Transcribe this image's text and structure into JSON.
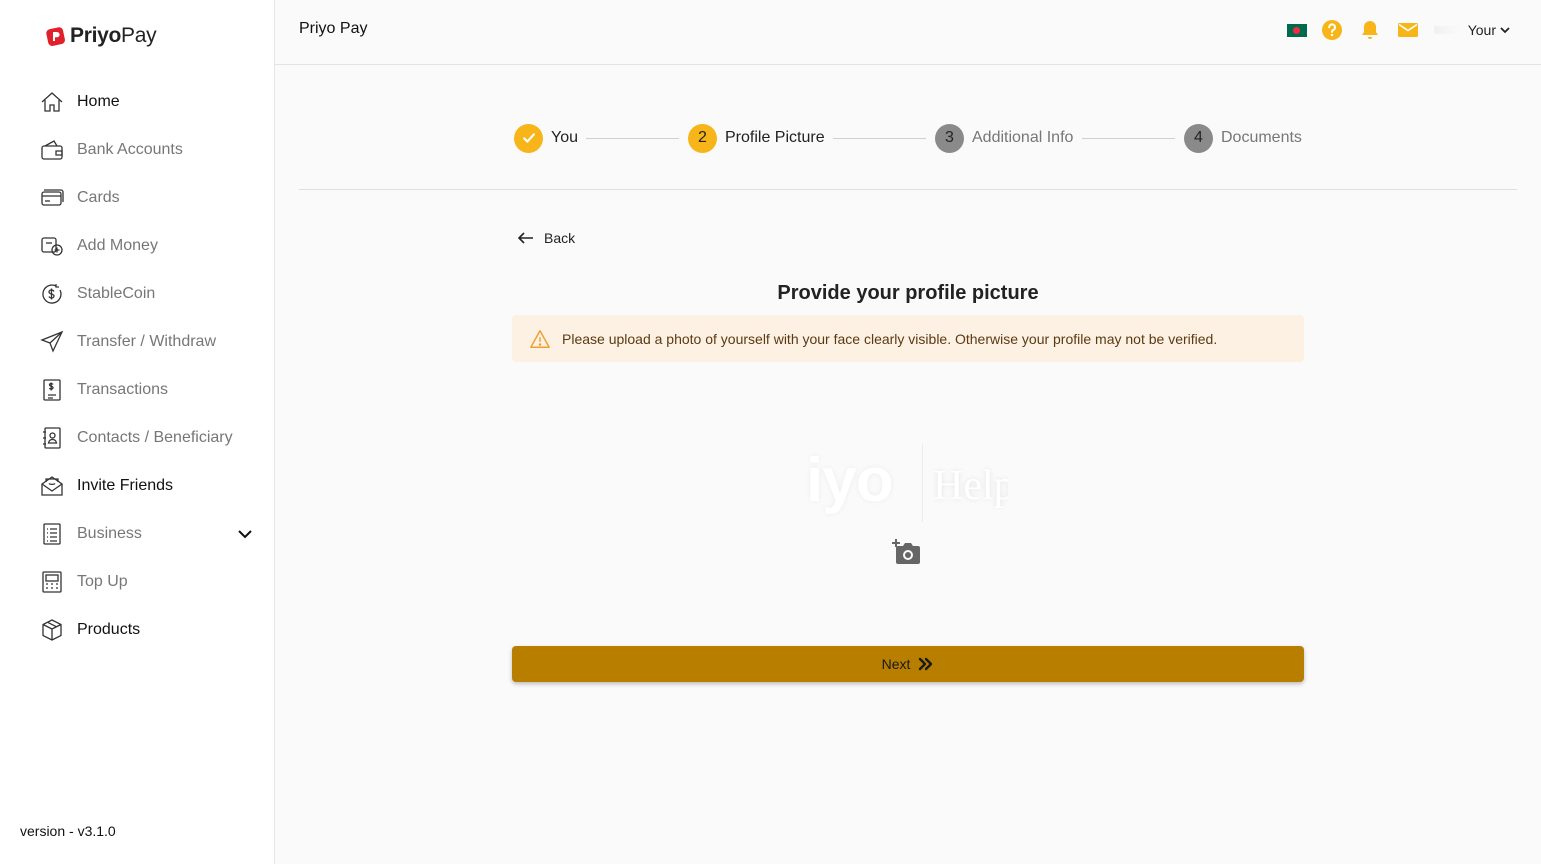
{
  "brand": {
    "bold": "Priyo",
    "light": "Pay",
    "color": "#e0202a"
  },
  "sidebar": {
    "items": [
      {
        "label": "Home",
        "icon": "home-icon",
        "strong": true
      },
      {
        "label": "Bank Accounts",
        "icon": "bank-wallet-icon",
        "strong": false
      },
      {
        "label": "Cards",
        "icon": "card-icon",
        "strong": false
      },
      {
        "label": "Add Money",
        "icon": "add-money-icon",
        "strong": false
      },
      {
        "label": "StableCoin",
        "icon": "stablecoin-icon",
        "strong": false
      },
      {
        "label": "Transfer / Withdraw",
        "icon": "paper-plane-icon",
        "strong": false
      },
      {
        "label": "Transactions",
        "icon": "receipt-icon",
        "strong": false
      },
      {
        "label": "Contacts / Beneficiary",
        "icon": "contacts-book-icon",
        "strong": false
      },
      {
        "label": "Invite Friends",
        "icon": "envelope-invite-icon",
        "strong": true
      },
      {
        "label": "Business",
        "icon": "document-list-icon",
        "strong": false
      },
      {
        "label": "Top Up",
        "icon": "top-up-icon",
        "strong": false
      },
      {
        "label": "Products",
        "icon": "box-icon",
        "strong": true
      }
    ],
    "version": "version - v3.1.0"
  },
  "header": {
    "title": "Priyo Pay",
    "user_label": "Your",
    "icons": [
      "bangladesh-flag-icon",
      "help-icon",
      "bell-icon",
      "mail-icon"
    ],
    "accent": "#f7b51a"
  },
  "stepper": {
    "steps": [
      {
        "number": "✓",
        "label": "You",
        "state": "done"
      },
      {
        "number": "2",
        "label": "Profile Picture",
        "state": "active"
      },
      {
        "number": "3",
        "label": "Additional Info",
        "state": "pending"
      },
      {
        "number": "4",
        "label": "Documents",
        "state": "pending"
      }
    ]
  },
  "content": {
    "back_label": "Back",
    "title": "Provide your profile picture",
    "warning": "Please upload a photo of yourself with your face clearly visible. Otherwise your profile may not be verified.",
    "ghost_logo_text": "iyo",
    "ghost_help_text": "Help",
    "next_label": "Next",
    "button_color": "#b77e00",
    "warning_bg": "#fdf1e3"
  }
}
